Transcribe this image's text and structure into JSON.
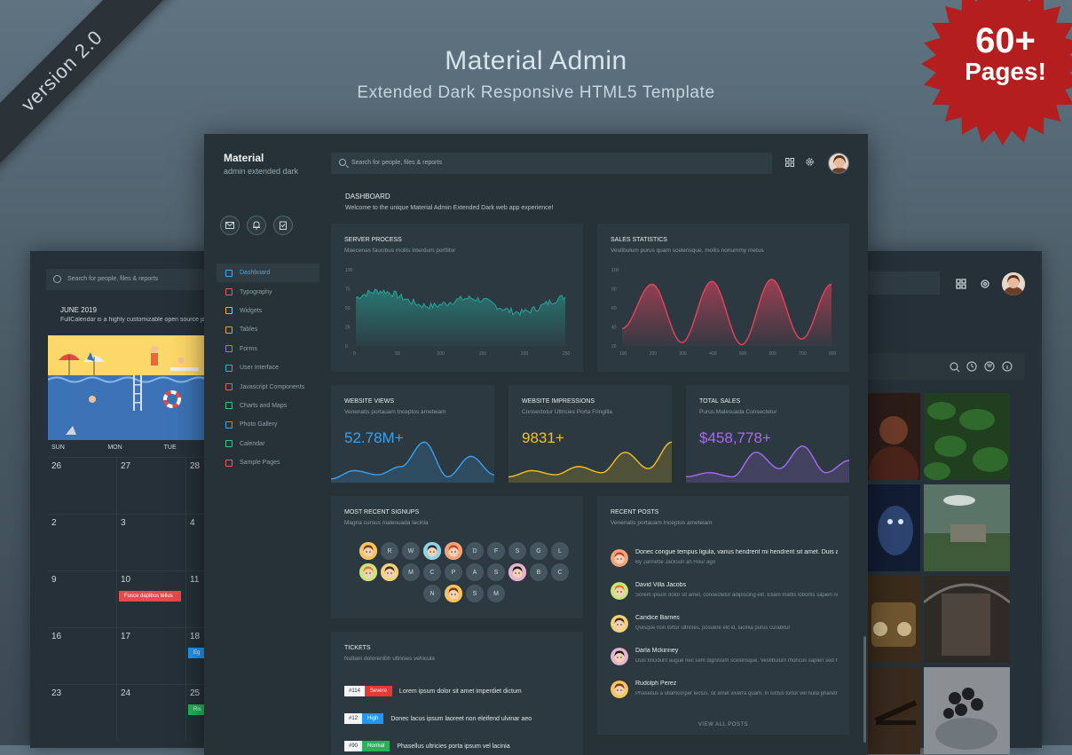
{
  "promo": {
    "title": "Material Admin",
    "subtitle": "Extended Dark Responsive HTML5 Template",
    "version": "version 2.0",
    "badge_big": "60+",
    "badge_small": "Pages!",
    "badge_color": "#b41e1e"
  },
  "back_left": {
    "search_placeholder": "Search for people, files & reports",
    "month": "JUNE 2019",
    "description": "FullCalendar is a highly customizable open source javascript",
    "days": [
      "SUN",
      "MON",
      "TUE"
    ],
    "weeks": [
      [
        "26",
        "27",
        "28"
      ],
      [
        "2",
        "3",
        "4"
      ],
      [
        "9",
        "10",
        "11"
      ],
      [
        "16",
        "17",
        "18"
      ],
      [
        "23",
        "24",
        "25"
      ]
    ],
    "events": [
      {
        "label": "Fusce dapibus tellus",
        "color": "#e64a4a"
      },
      {
        "label": "Eg",
        "color": "#2196f3"
      },
      {
        "label": "Ris",
        "color": "#27b35a"
      }
    ]
  },
  "app": {
    "brand_title": "Material",
    "brand_subtitle": "admin extended dark",
    "search_placeholder": "Search for people, files & reports",
    "accent": "#3fa9f5",
    "nav": [
      {
        "label": "Dashboard",
        "icon": "home-icon",
        "active": true,
        "color": "#3fa9f5"
      },
      {
        "label": "Typography",
        "icon": "typography-icon",
        "color": "#e35d5d"
      },
      {
        "label": "Widgets",
        "icon": "widgets-icon",
        "color": "#f3b13d"
      },
      {
        "label": "Tables",
        "icon": "tables-icon",
        "color": "#f39c3d"
      },
      {
        "label": "Forms",
        "icon": "forms-icon",
        "color": "#8e7cf0"
      },
      {
        "label": "User Interface",
        "icon": "ui-icon",
        "color": "#29b6c9"
      },
      {
        "label": "Javascript Components",
        "icon": "js-icon",
        "color": "#e35d5d"
      },
      {
        "label": "Charts and Maps",
        "icon": "charts-icon",
        "color": "#3fc380"
      },
      {
        "label": "Photo Gallery",
        "icon": "gallery-icon",
        "color": "#3fa9f5"
      },
      {
        "label": "Calendar",
        "icon": "calendar-icon",
        "color": "#3fc380"
      },
      {
        "label": "Sample Pages",
        "icon": "pages-icon",
        "color": "#e35d5d"
      }
    ]
  },
  "dashboard": {
    "title": "DASHBOARD",
    "subtitle": "Welcome to the unique Material Admin Extended Dark web app experience!",
    "server_process": {
      "title": "SERVER PROCESS",
      "subtitle": "Maecenas faucibus mollis interdum porttitor",
      "color": "#26a69a",
      "y_ticks": [
        "100",
        "75",
        "50",
        "25",
        "0"
      ],
      "x_ticks": [
        "0",
        "50",
        "100",
        "150",
        "200",
        "250"
      ]
    },
    "sales_statistics": {
      "title": "SALES STATISTICS",
      "subtitle": "Vestibulum purus quam scelerisque, mollis nonummy metus",
      "color": "#e5435e",
      "y_ticks": [
        "100",
        "80",
        "60",
        "40",
        "20"
      ],
      "x_ticks": [
        "100",
        "200",
        "300",
        "400",
        "500",
        "600",
        "700",
        "800"
      ]
    },
    "stats": [
      {
        "title": "WEBSITE VIEWS",
        "subtitle": "Venenatis portauam Inceptos ameteiam",
        "value": "52.78M+",
        "color": "#3aa1f0"
      },
      {
        "title": "WEBSITE IMPRESSIONS",
        "subtitle": "Consectetur Ultricies Porta Fringilla",
        "value": "9831+",
        "color": "#f5c21b"
      },
      {
        "title": "TOTAL SALES",
        "subtitle": "Purus Malesuada Consectetur",
        "value": "$458,778+",
        "color": "#a66bf0"
      }
    ],
    "signups": {
      "title": "MOST RECENT SIGNUPS",
      "subtitle": "Magna cursus malesuada lacinia",
      "rows": [
        [
          "@",
          "R",
          "W",
          "@",
          "@",
          "D",
          "F",
          "S",
          "G",
          "L"
        ],
        [
          "@",
          "@",
          "M",
          "C",
          "P",
          "A",
          "S",
          "@",
          "B",
          "C"
        ],
        [
          "N",
          "@",
          "S",
          "M"
        ]
      ]
    },
    "tickets": {
      "title": "TICKETS",
      "subtitle": "Nullam dolorenibh ultricies vehicula",
      "items": [
        {
          "id": "#114",
          "badge": "Severe",
          "color": "#e53935",
          "text": "Lorem ipsum dolor sit amet imperdiet dictum"
        },
        {
          "id": "#12",
          "badge": "High",
          "color": "#2196f3",
          "text": "Donec lacus ipsum laoreet non eleifend ulvinar aeo"
        },
        {
          "id": "#90",
          "badge": "Normal",
          "color": "#27b35a",
          "text": "Phasellus ultricies porta ipsum vel lacinia"
        }
      ]
    },
    "recent_posts": {
      "title": "RECENT POSTS",
      "subtitle": "Venenatis portauam Inceptos ameteiam",
      "view_all": "VIEW ALL POSTS",
      "items": [
        {
          "title": "Donec congue tempus ligula, varius hendrerit mi hendrerit sit amet. Duis ac quam sit amet",
          "meta": "By Jannette Jackson an Hour ago"
        },
        {
          "title": "David Villa Jacobs",
          "meta": "Sorem ipsum dolor sit amet, consectetur adipiscing elit. Etiam mattis lobortis sapien non posuere"
        },
        {
          "title": "Candice Barnes",
          "meta": "Quisque non tortor ultricies, posuere elit id, lacinia purus curabitur"
        },
        {
          "title": "Darla Mckinney",
          "meta": "Duis tincidunt augue nec sem dignissim scelerisque. Vestibulum rhoncus sapien sed nulla aliquam"
        },
        {
          "title": "Rudolph Perez",
          "meta": "Phasellus a ullamcorper lectus, sit amet viverra quam. In luctus tortor vel nulla pharetra"
        }
      ]
    }
  }
}
